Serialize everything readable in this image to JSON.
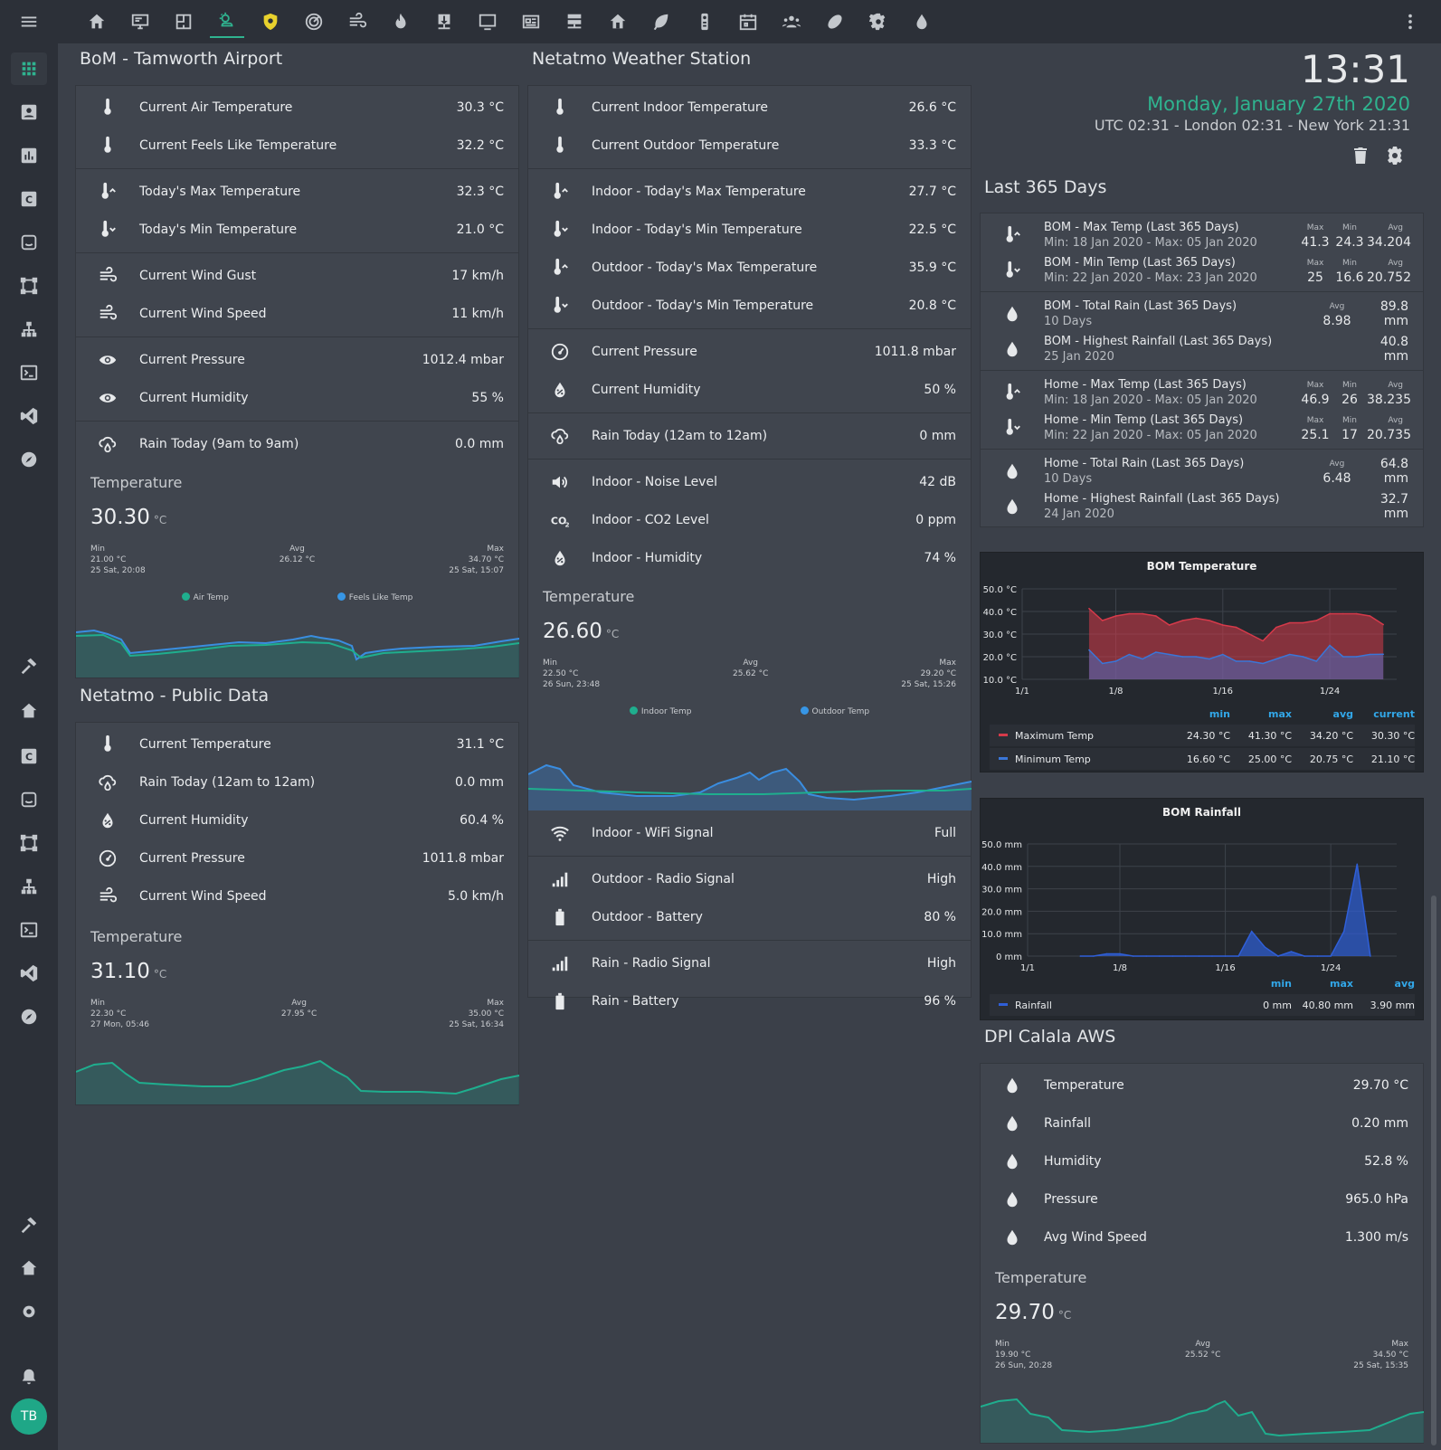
{
  "topbar": {
    "icons": [
      "home-icon",
      "monitor-dashboard-icon",
      "floorplan-icon",
      "weather-icon",
      "security-icon",
      "radar-icon",
      "wind-icon",
      "fire-icon",
      "download-icon",
      "monitor-icon",
      "news-icon",
      "server-icon",
      "home-group-icon",
      "leaf-icon",
      "remote-icon",
      "calendar-icon",
      "people-icon",
      "rugby-icon",
      "settings-icon",
      "water-icon"
    ]
  },
  "user": {
    "initials": "TB"
  },
  "clock": {
    "time": "13:31",
    "date": "Monday, January 27th 2020",
    "zones": "UTC 02:31 - London 02:31 - New York 21:31"
  },
  "bom": {
    "title": "BoM - Tamworth Airport",
    "groups": [
      [
        {
          "icon": "thermometer-icon",
          "label": "Current Air Temperature",
          "value": "30.3 °C"
        },
        {
          "icon": "thermometer-icon",
          "label": "Current Feels Like Temperature",
          "value": "32.2 °C"
        }
      ],
      [
        {
          "icon": "thermometer-up-icon",
          "label": "Today's Max Temperature",
          "value": "32.3 °C"
        },
        {
          "icon": "thermometer-down-icon",
          "label": "Today's Min Temperature",
          "value": "21.0 °C"
        }
      ],
      [
        {
          "icon": "wind-icon",
          "label": "Current Wind Gust",
          "value": "17 km/h"
        },
        {
          "icon": "wind-icon",
          "label": "Current Wind Speed",
          "value": "11 km/h"
        }
      ],
      [
        {
          "icon": "eye-icon",
          "label": "Current Pressure",
          "value": "1012.4 mbar"
        },
        {
          "icon": "eye-icon",
          "label": "Current Humidity",
          "value": "55 %"
        }
      ],
      [
        {
          "icon": "rain-cloud-icon",
          "label": "Rain Today (9am to 9am)",
          "value": "0.0 mm"
        }
      ]
    ],
    "graph": {
      "title": "Temperature",
      "value": "30.30",
      "unit": "°C",
      "min_label": "Min",
      "min_value": "21.00 °C",
      "min_time": "25 Sat, 20:08",
      "avg_label": "Avg",
      "avg_value": "26.12 °C",
      "max_label": "Max",
      "max_value": "34.70 °C",
      "max_time": "25 Sat, 15:07",
      "legend": [
        "Air Temp",
        "Feels Like Temp"
      ]
    }
  },
  "public": {
    "title": "Netatmo - Public Data",
    "rows": [
      {
        "icon": "thermometer-icon",
        "label": "Current Temperature",
        "value": "31.1 °C"
      },
      {
        "icon": "rain-cloud-icon",
        "label": "Rain Today (12am to 12am)",
        "value": "0.0 mm"
      },
      {
        "icon": "water-percent-icon",
        "label": "Current Humidity",
        "value": "60.4 %"
      },
      {
        "icon": "gauge-icon",
        "label": "Current Pressure",
        "value": "1011.8 mbar"
      },
      {
        "icon": "wind-icon",
        "label": "Current Wind Speed",
        "value": "5.0 km/h"
      }
    ],
    "graph": {
      "title": "Temperature",
      "value": "31.10",
      "unit": "°C",
      "min_label": "Min",
      "min_value": "22.30 °C",
      "min_time": "27 Mon, 05:46",
      "avg_label": "Avg",
      "avg_value": "27.95 °C",
      "max_label": "Max",
      "max_value": "35.00 °C",
      "max_time": "25 Sat, 16:34"
    }
  },
  "netatmo": {
    "title": "Netatmo Weather Station",
    "groups": [
      [
        {
          "icon": "thermometer-icon",
          "label": "Current Indoor Temperature",
          "value": "26.6 °C"
        },
        {
          "icon": "thermometer-icon",
          "label": "Current Outdoor Temperature",
          "value": "33.3 °C"
        }
      ],
      [
        {
          "icon": "thermometer-up-icon",
          "label": "Indoor - Today's Max Temperature",
          "value": "27.7 °C"
        },
        {
          "icon": "thermometer-down-icon",
          "label": "Indoor - Today's Min Temperature",
          "value": "22.5 °C"
        },
        {
          "icon": "thermometer-up-icon",
          "label": "Outdoor - Today's Max Temperature",
          "value": "35.9 °C"
        },
        {
          "icon": "thermometer-down-icon",
          "label": "Outdoor - Today's Min Temperature",
          "value": "20.8 °C"
        }
      ],
      [
        {
          "icon": "gauge-icon",
          "label": "Current Pressure",
          "value": "1011.8 mbar"
        },
        {
          "icon": "water-percent-icon",
          "label": "Current Humidity",
          "value": "50 %"
        }
      ],
      [
        {
          "icon": "rain-cloud-icon",
          "label": "Rain Today (12am to 12am)",
          "value": "0 mm"
        }
      ],
      [
        {
          "icon": "volume-icon",
          "label": "Indoor - Noise Level",
          "value": "42 dB"
        },
        {
          "icon": "co2-icon",
          "label": "Indoor - CO2 Level",
          "value": "0 ppm"
        },
        {
          "icon": "water-percent-icon",
          "label": "Indoor - Humidity",
          "value": "74 %"
        }
      ]
    ],
    "graph": {
      "title": "Temperature",
      "value": "26.60",
      "unit": "°C",
      "min_label": "Min",
      "min_value": "22.50 °C",
      "min_time": "26 Sun, 23:48",
      "avg_label": "Avg",
      "avg_value": "25.62 °C",
      "max_label": "Max",
      "max_value": "29.20 °C",
      "max_time": "25 Sat, 15:26",
      "legend": [
        "Indoor Temp",
        "Outdoor Temp"
      ]
    },
    "groups2": [
      [
        {
          "icon": "wifi-icon",
          "label": "Indoor - WiFi Signal",
          "value": "Full"
        }
      ],
      [
        {
          "icon": "signal-icon",
          "label": "Outdoor - Radio Signal",
          "value": "High"
        },
        {
          "icon": "battery-icon",
          "label": "Outdoor - Battery",
          "value": "80 %"
        }
      ],
      [
        {
          "icon": "signal-icon",
          "label": "Rain - Radio Signal",
          "value": "High"
        },
        {
          "icon": "battery-icon",
          "label": "Rain - Battery",
          "value": "96 %"
        }
      ]
    ]
  },
  "last365": {
    "title": "Last 365 Days",
    "rows": [
      {
        "icon": "thermometer-up-icon",
        "name": "BOM - Max Temp (Last 365 Days)",
        "sub": "Min: 18 Jan 2020 - Max: 05 Jan 2020",
        "max": "41.3",
        "min": "24.3",
        "avg": "34.204"
      },
      {
        "icon": "thermometer-down-icon",
        "name": "BOM - Min Temp (Last 365 Days)",
        "sub": "Min: 22 Jan 2020 - Max: 23 Jan 2020",
        "max": "25",
        "min": "16.6",
        "avg": "20.752"
      },
      {
        "icon": "water-icon",
        "name": "BOM - Total Rain (Last 365 Days)",
        "sub": "10 Days",
        "avg": "8.98",
        "total": "89.8 mm"
      },
      {
        "icon": "water-icon",
        "name": "BOM - Highest Rainfall (Last 365 Days)",
        "sub": "25 Jan 2020",
        "total": "40.8 mm"
      },
      {
        "icon": "thermometer-up-icon",
        "name": "Home - Max Temp (Last 365 Days)",
        "sub": "Min: 18 Jan 2020 - Max: 05 Jan 2020",
        "max": "46.9",
        "min": "26",
        "avg": "38.235"
      },
      {
        "icon": "thermometer-down-icon",
        "name": "Home - Min Temp (Last 365 Days)",
        "sub": "Min: 22 Jan 2020 - Max: 05 Jan 2020",
        "max": "25.1",
        "min": "17",
        "avg": "20.735"
      },
      {
        "icon": "water-icon",
        "name": "Home - Total Rain (Last 365 Days)",
        "sub": "10 Days",
        "avg": "6.48",
        "total": "64.8 mm"
      },
      {
        "icon": "water-icon",
        "name": "Home - Highest Rainfall (Last 365 Days)",
        "sub": "24 Jan 2020",
        "total": "32.7 mm"
      }
    ],
    "labels": {
      "max": "Max",
      "min": "Min",
      "avg": "Avg"
    }
  },
  "dpi": {
    "title": "DPI Calala AWS",
    "rows": [
      {
        "icon": "water-icon",
        "label": "Temperature",
        "value": "29.70 °C"
      },
      {
        "icon": "water-icon",
        "label": "Rainfall",
        "value": "0.20 mm"
      },
      {
        "icon": "water-icon",
        "label": "Humidity",
        "value": "52.8 %"
      },
      {
        "icon": "water-icon",
        "label": "Pressure",
        "value": "965.0 hPa"
      },
      {
        "icon": "water-icon",
        "label": "Avg Wind Speed",
        "value": "1.300 m/s"
      }
    ],
    "graph": {
      "title": "Temperature",
      "value": "29.70",
      "unit": "°C",
      "min_label": "Min",
      "min_value": "19.90 °C",
      "min_time": "26 Sun, 20:28",
      "avg_label": "Avg",
      "avg_value": "25.52 °C",
      "max_label": "Max",
      "max_value": "34.50 °C",
      "max_time": "25 Sat, 15:35"
    }
  },
  "chart_data": [
    {
      "type": "area",
      "title": "BOM Temperature",
      "x_ticks": [
        "1/1",
        "1/8",
        "1/16",
        "1/24"
      ],
      "y_ticks": [
        "50.0 °C",
        "40.0 °C",
        "30.0 °C",
        "20.0 °C",
        "10.0 °C"
      ],
      "ylim": [
        10,
        50
      ],
      "x": [
        6,
        7,
        8,
        9,
        10,
        11,
        12,
        13,
        14,
        15,
        16,
        17,
        18,
        19,
        20,
        21,
        22,
        23,
        24,
        25,
        26,
        27,
        28
      ],
      "series": [
        {
          "name": "Maximum Temp",
          "color": "#d63a4a",
          "values": [
            41.3,
            36,
            38,
            39,
            39,
            38,
            34,
            36,
            37,
            36,
            34,
            33,
            30,
            27,
            33,
            35,
            35,
            36,
            39,
            39,
            39,
            38,
            34.2
          ]
        },
        {
          "name": "Minimum Temp",
          "color": "#3a76d8",
          "values": [
            23,
            17,
            18,
            21,
            19,
            22,
            21,
            20,
            20,
            19,
            21,
            18,
            18,
            17,
            19,
            21,
            20,
            18,
            25,
            20,
            20,
            21,
            21.1
          ]
        }
      ],
      "table": {
        "headers": [
          "min",
          "max",
          "avg",
          "current"
        ],
        "rows": [
          {
            "name": "Maximum Temp",
            "min": "24.30 °C",
            "max": "41.30 °C",
            "avg": "34.20 °C",
            "current": "30.30 °C"
          },
          {
            "name": "Minimum Temp",
            "min": "16.60 °C",
            "max": "25.00 °C",
            "avg": "20.75 °C",
            "current": "21.10 °C"
          }
        ]
      }
    },
    {
      "type": "area",
      "title": "BOM Rainfall",
      "x_ticks": [
        "1/1",
        "1/8",
        "1/16",
        "1/24"
      ],
      "y_ticks": [
        "50.0 mm",
        "40.0 mm",
        "30.0 mm",
        "20.0 mm",
        "10.0 mm",
        "0 mm"
      ],
      "ylim": [
        0,
        50
      ],
      "x": [
        5,
        6,
        7,
        8,
        9,
        10,
        11,
        12,
        13,
        14,
        15,
        16,
        17,
        18,
        19,
        20,
        21,
        22,
        23,
        24,
        25,
        26,
        27
      ],
      "series": [
        {
          "name": "Rainfall",
          "color": "#2f5fd8",
          "values": [
            0,
            0,
            1,
            1,
            0,
            0,
            0,
            0,
            0,
            0,
            0,
            0,
            0,
            11,
            4,
            0,
            2,
            0,
            0,
            0,
            11,
            41,
            0
          ]
        }
      ],
      "table": {
        "headers": [
          "min",
          "max",
          "avg"
        ],
        "rows": [
          {
            "name": "Rainfall",
            "min": "0 mm",
            "max": "40.80 mm",
            "avg": "3.90 mm"
          }
        ]
      }
    }
  ]
}
